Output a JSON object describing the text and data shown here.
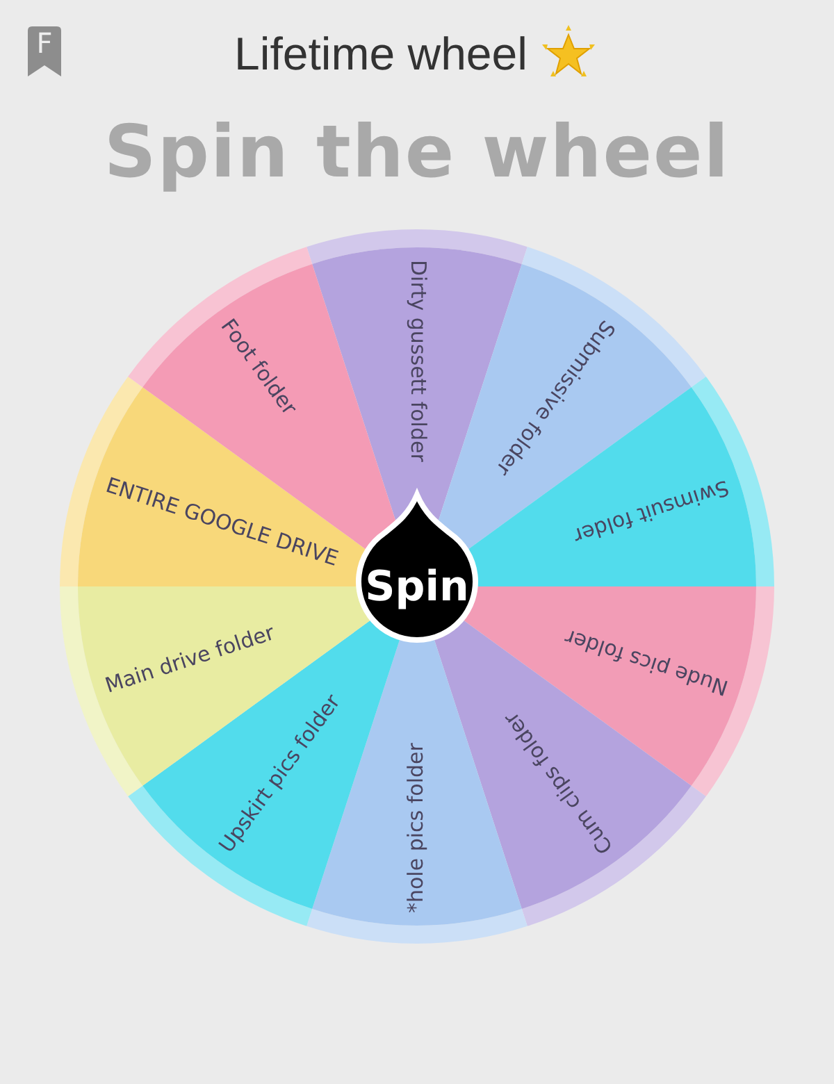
{
  "bookmark": {
    "letter": "F"
  },
  "header": {
    "title": "Lifetime wheel"
  },
  "heading": "Spin the wheel",
  "wheel": {
    "segments": [
      {
        "label": "Dirty gussett folder",
        "color": "#b4a3de"
      },
      {
        "label": "Submissive folder",
        "color": "#a9c9f1"
      },
      {
        "label": "Swimsuit folder",
        "color": "#52dcec"
      },
      {
        "label": "Nude pics folder",
        "color": "#f29cb6"
      },
      {
        "label": "Cum clips folder",
        "color": "#b4a3de"
      },
      {
        "label": "*hole pics folder",
        "color": "#a9c9f1"
      },
      {
        "label": "Upskirt pics folder",
        "color": "#52dcec"
      },
      {
        "label": "Main drive folder",
        "color": "#e8eca2"
      },
      {
        "label": "ENTIRE GOOGLE DRIVE",
        "color": "#f8d87a"
      },
      {
        "label": "Foot folder",
        "color": "#f49bb5"
      }
    ],
    "spin_button": "Spin"
  }
}
